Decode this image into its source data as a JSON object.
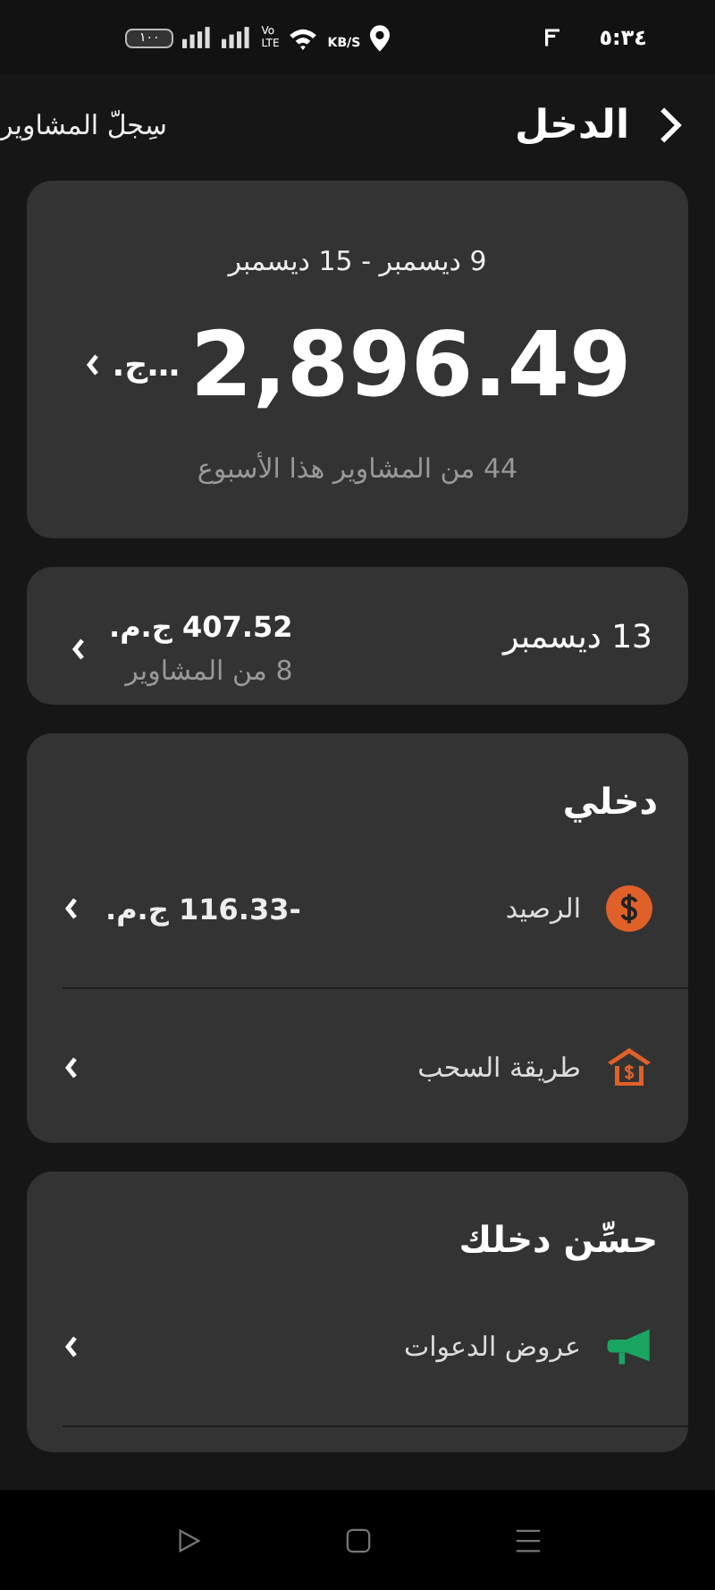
{
  "status_bar": {
    "time": "٥:٣٤",
    "battery": "١٠٠",
    "volte_top": "Vo",
    "volte_bottom": "LTE",
    "speed": "KB/S"
  },
  "header": {
    "title": "الدخل",
    "link": "سِجلّ المشاوير"
  },
  "week_card": {
    "range": "9 ديسمبر - 15 ديسمبر",
    "amount": "2,896.49",
    "currency": "…ج.",
    "trips": "44 من المشاوير هذا الأسبوع"
  },
  "day_card": {
    "date": "13 ديسمبر",
    "amount": "407.52 ج.م.",
    "trips": "8 من المشاوير"
  },
  "sections": [
    {
      "title": "دخلي",
      "rows": [
        {
          "kind": "balance",
          "label": "الرصيد",
          "value": "-116.33 ج.م."
        },
        {
          "kind": "payout",
          "label": "طريقة السحب"
        }
      ]
    },
    {
      "title": "حسِّن دخلك",
      "rows": [
        {
          "kind": "referral",
          "label": "عروض الدعوات"
        }
      ]
    }
  ]
}
